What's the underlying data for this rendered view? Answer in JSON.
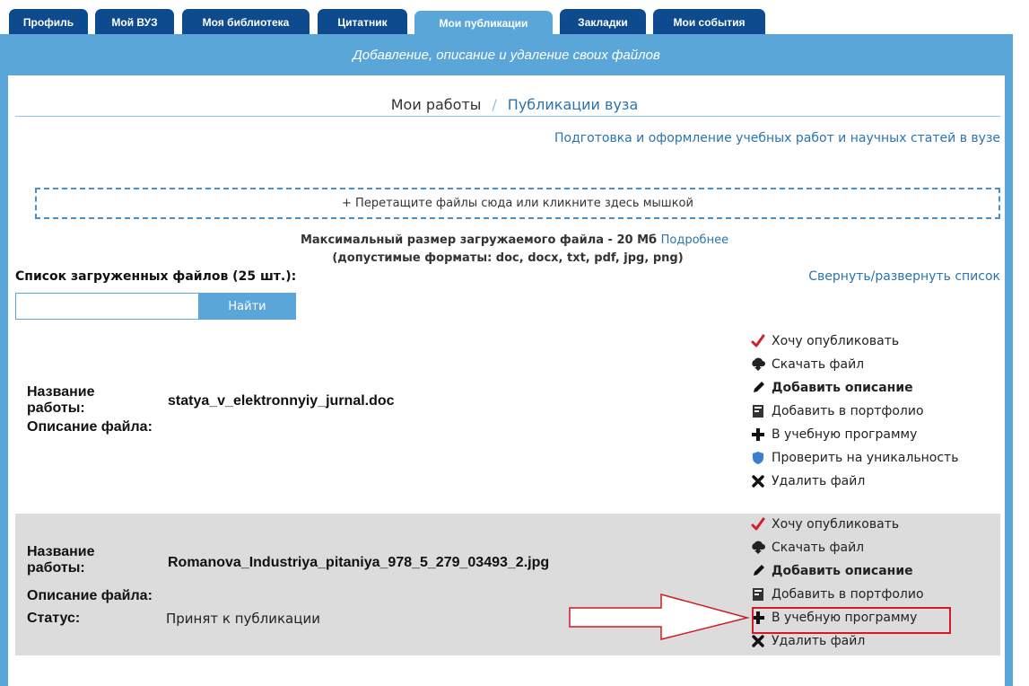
{
  "tabs": [
    {
      "label": "Профиль"
    },
    {
      "label": "Мой ВУЗ"
    },
    {
      "label": "Моя библиотека"
    },
    {
      "label": "Цитатник"
    },
    {
      "label": "Мои публикации"
    },
    {
      "label": "Закладки"
    },
    {
      "label": "Мои события"
    }
  ],
  "active_tab": "Мои публикации",
  "banner": "Добавление, описание и удаление своих файлов",
  "subnav": {
    "my_works": "Мои работы",
    "separator": "/",
    "university": "Публикации вуза"
  },
  "guide_link": "Подготовка и оформление учебных работ и научных статей в вузе",
  "dropzone": "+ Перетащите файлы сюда или кликните здесь мышкой",
  "max_size": {
    "text": "Максимальный размер загружаемого файла - 20 Мб",
    "more": "Подробнее"
  },
  "formats": "(допустимые форматы: doc, docx, txt, pdf, jpg, png)",
  "list_title": "Список загруженных файлов (25 шт.):",
  "collapse_link": "Свернуть/развернуть список",
  "search": {
    "placeholder": "",
    "button": "Найти"
  },
  "labels": {
    "title_1": "Название",
    "title_2": "работы:",
    "description": "Описание файла:",
    "status": "Статус:"
  },
  "records": [
    {
      "filename": "statya_v_elektronnyiy_jurnal.doc",
      "actions": [
        {
          "label": "Хочу опубликовать",
          "icon": "checkmark-icon"
        },
        {
          "label": "Скачать файл",
          "icon": "cloud-download-icon"
        },
        {
          "label": "Добавить описание",
          "icon": "pencil-icon"
        },
        {
          "label": "Добавить в портфолио",
          "icon": "portfolio-icon"
        },
        {
          "label": "В учебную программу",
          "icon": "plus-icon"
        },
        {
          "label": "Проверить на уникальность",
          "icon": "shield-icon"
        },
        {
          "label": "Удалить файл",
          "icon": "delete-x-icon"
        }
      ]
    },
    {
      "filename": "Romanova_Industriya_pitaniya_978_5_279_03493_2.jpg",
      "status": "Принят к публикации",
      "actions": [
        {
          "label": "Хочу опубликовать",
          "icon": "checkmark-icon"
        },
        {
          "label": "Скачать файл",
          "icon": "cloud-download-icon"
        },
        {
          "label": "Добавить описание",
          "icon": "pencil-icon"
        },
        {
          "label": "Добавить в портфолио",
          "icon": "portfolio-icon"
        },
        {
          "label": "В учебную программу",
          "icon": "plus-icon"
        },
        {
          "label": "Удалить файл",
          "icon": "delete-x-icon"
        }
      ]
    }
  ],
  "colors": {
    "tab": "#0d4a8e",
    "accent": "#5ba6d9",
    "link": "#2b74b0",
    "highlight": "#d01b24",
    "check": "#d0202a",
    "shield": "#3a7fd0"
  }
}
